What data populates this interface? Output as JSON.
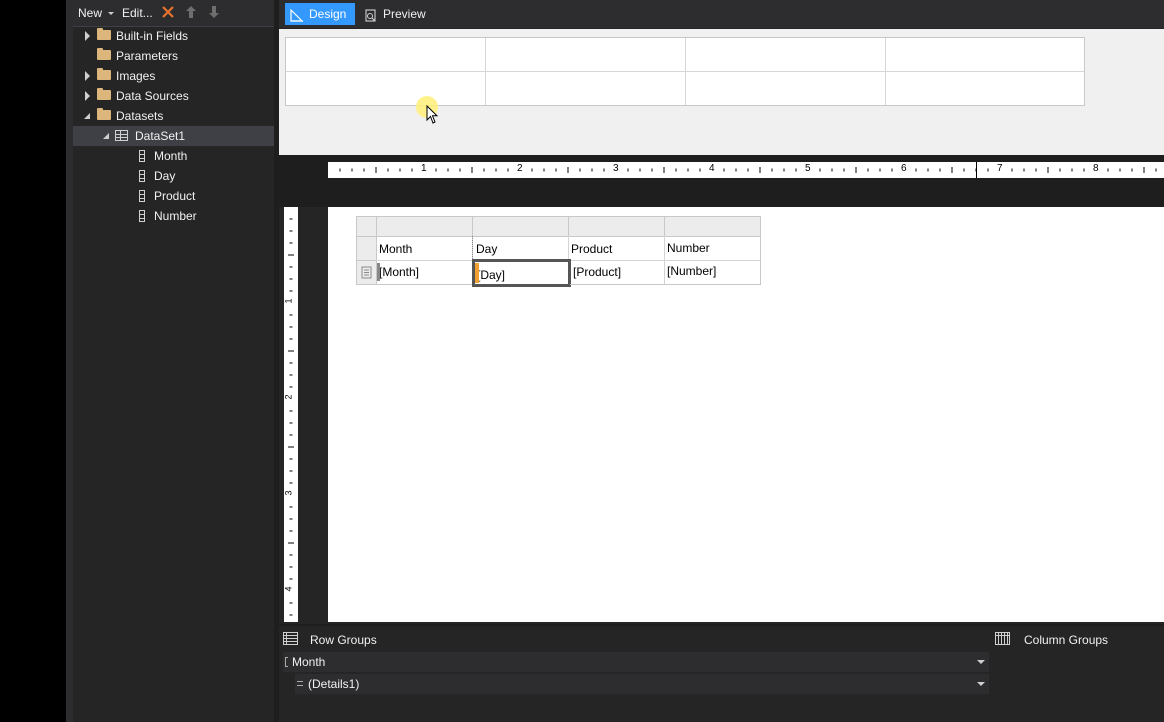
{
  "toolbar": {
    "new_label": "New",
    "edit_label": "Edit...",
    "icons": [
      "dropdown-arrow-icon",
      "delete-icon",
      "move-up-icon",
      "move-down-icon"
    ]
  },
  "tree": {
    "builtin_fields": "Built-in Fields",
    "parameters": "Parameters",
    "images": "Images",
    "data_sources": "Data Sources",
    "datasets": "Datasets",
    "dataset1": "DataSet1",
    "fields": [
      "Month",
      "Day",
      "Product",
      "Number"
    ]
  },
  "tabs": {
    "design": "Design",
    "preview": "Preview"
  },
  "ruler": {
    "h_labels": [
      "1",
      "2",
      "3",
      "4",
      "5",
      "6",
      "7",
      "8"
    ],
    "v_labels": [
      "1",
      "2",
      "3",
      "4"
    ]
  },
  "tablix": {
    "headers": [
      "Month",
      "Day",
      "Product",
      "Number"
    ],
    "details": [
      "[Month]",
      "[Day]",
      "[Product]",
      "[Number]"
    ]
  },
  "groups": {
    "row_groups_title": "Row Groups",
    "column_groups_title": "Column Groups",
    "row_group_items": [
      "Month",
      "(Details1)"
    ]
  },
  "colors": {
    "accent": "#3399ff",
    "folder": "#dcb67a",
    "selection_orange": "#f0a030"
  }
}
